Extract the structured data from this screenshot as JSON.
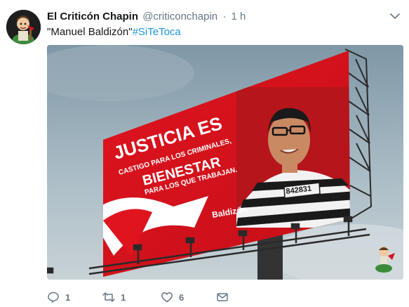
{
  "author": {
    "display_name": "El Criticón Chapin",
    "handle": "@criticonchapin",
    "separator": "·",
    "timestamp": "1 h"
  },
  "tweet": {
    "text_quote": "\"Manuel Baldizón\"",
    "hashtag": "#SiTeToca"
  },
  "media": {
    "billboard_headline_1": "JUSTICIA ES",
    "billboard_line_1": "CASTIGO PARA LOS CRIMINALES,",
    "billboard_headline_2": "BIENESTAR",
    "billboard_line_2": "PARA LOS QUE TRABAJAN.",
    "billboard_signature": "Baldizón",
    "inmate_number": "842831"
  },
  "actions": {
    "reply_count": "1",
    "retweet_count": "1",
    "like_count": "6"
  },
  "icons": {
    "avatar": "avatar-cartoon-icon",
    "caret": "chevron-down-icon",
    "reply": "reply-icon",
    "retweet": "retweet-icon",
    "like": "heart-icon",
    "dm": "envelope-icon"
  },
  "colors": {
    "link": "#1b95e0",
    "muted": "#657786",
    "billboard_red": "#d4121e"
  }
}
